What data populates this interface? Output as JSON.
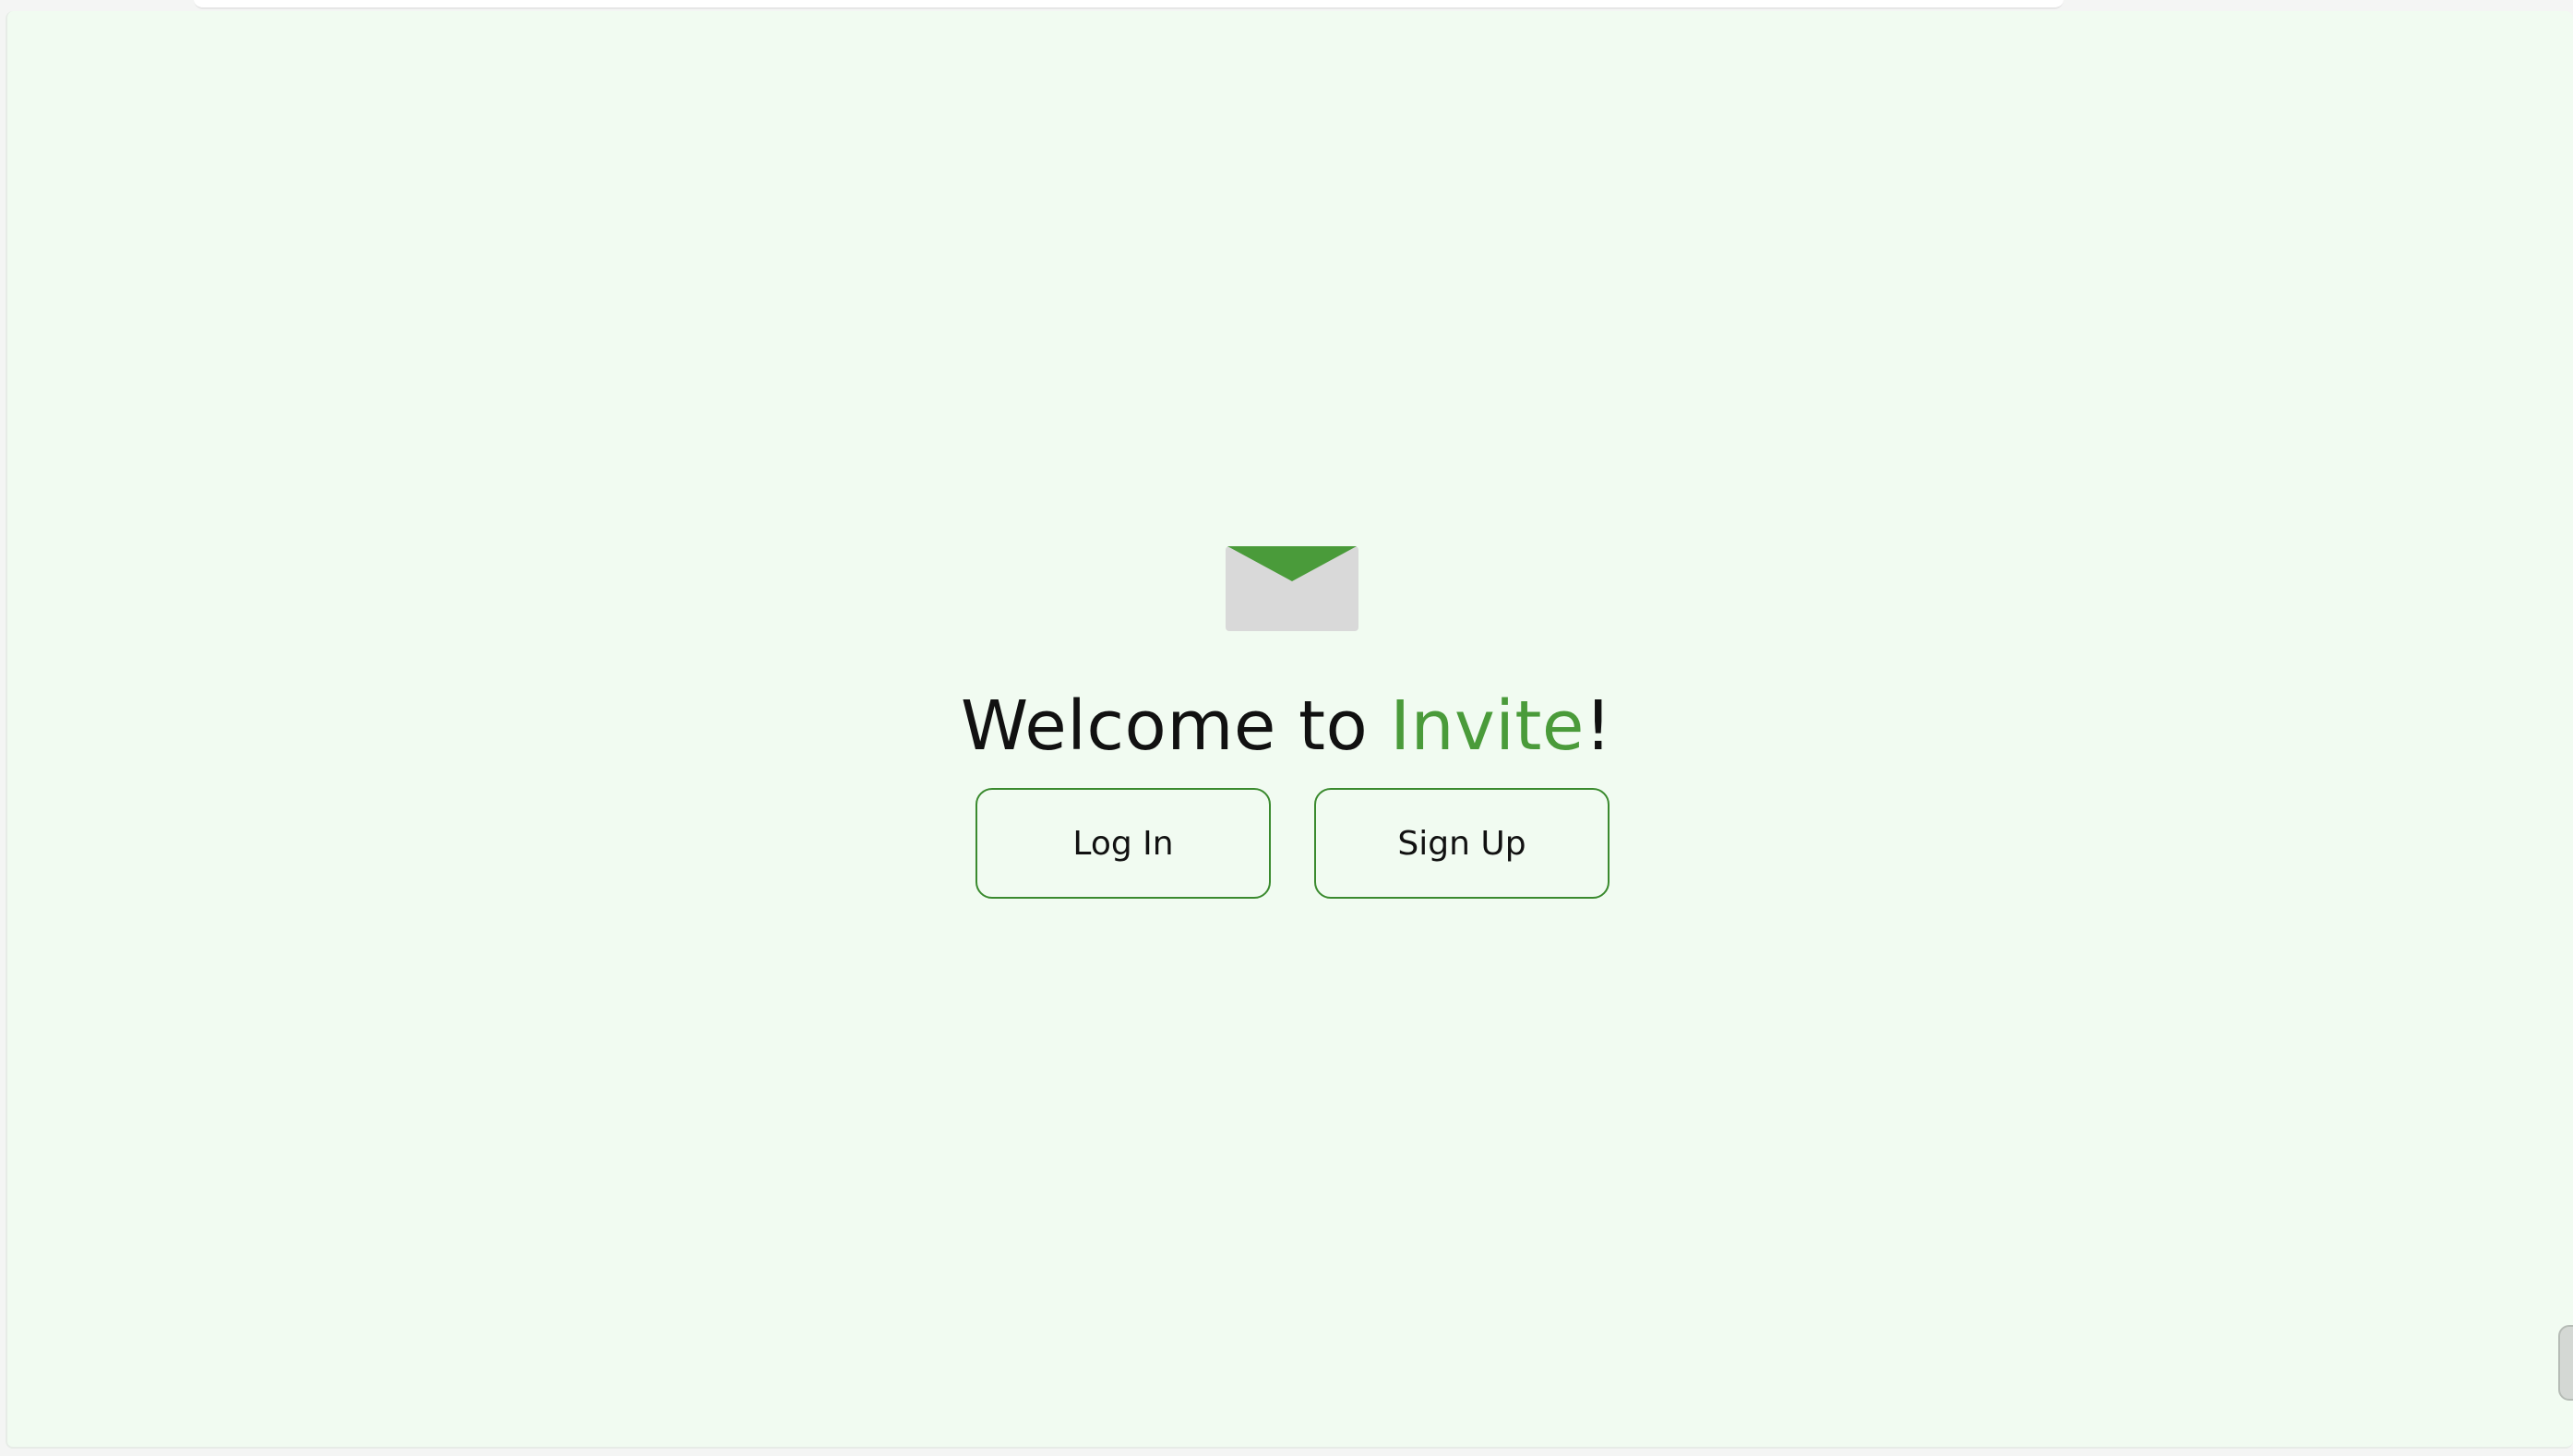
{
  "welcome": {
    "prefix": "Welcome to ",
    "brand": "Invite",
    "suffix": "!"
  },
  "buttons": {
    "login_label": "Log In",
    "signup_label": "Sign Up"
  },
  "icons": {
    "logo": "envelope-icon"
  },
  "colors": {
    "background": "#f1fbf1",
    "brand_green": "#4a9b3a",
    "button_border": "#3a8a2e",
    "envelope_body": "#d9d9d9",
    "text": "#111111"
  }
}
